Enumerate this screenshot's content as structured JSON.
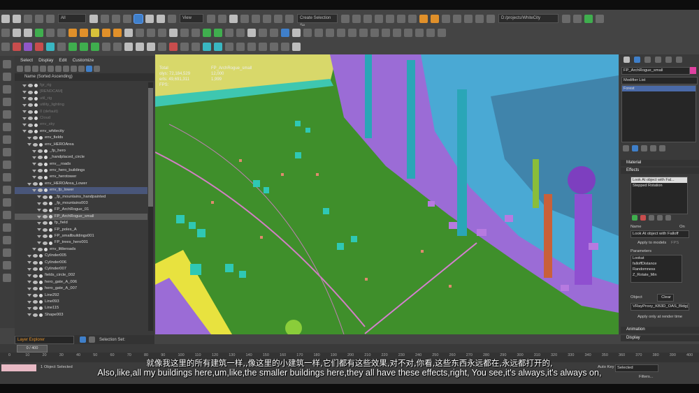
{
  "toolbar": {
    "filter_dropdown": "All",
    "view_dropdown": "View",
    "selection_set": "Create Selection Se",
    "project_path": "D:/projects/WhiteCity"
  },
  "explorer": {
    "menu": [
      "Select",
      "Display",
      "Edit",
      "Customize"
    ],
    "column_header": "Name (Sorted Ascending)",
    "items": [
      {
        "label": "fgr_rig",
        "depth": 1,
        "state": "dim"
      },
      {
        "label": "[RENDCAM]",
        "depth": 1,
        "state": "dim"
      },
      {
        "label": "util_rig",
        "depth": 1,
        "state": "dim"
      },
      {
        "label": "utility_lighting",
        "depth": 1,
        "state": "dim"
      },
      {
        "label": "0 (default)",
        "depth": 1,
        "state": "dim"
      },
      {
        "label": "Cloud",
        "depth": 1,
        "state": "dim"
      },
      {
        "label": "env_sky",
        "depth": 1,
        "state": "dim"
      },
      {
        "label": "env_whitecity",
        "depth": 1,
        "state": ""
      },
      {
        "label": "env_fields",
        "depth": 2,
        "state": ""
      },
      {
        "label": "env_HEROArea",
        "depth": 2,
        "state": ""
      },
      {
        "label": "_fp_hero",
        "depth": 3,
        "state": ""
      },
      {
        "label": "_handplaced_circle",
        "depth": 3,
        "state": ""
      },
      {
        "label": "env__roads",
        "depth": 3,
        "state": ""
      },
      {
        "label": "env_hero_buildings",
        "depth": 3,
        "state": ""
      },
      {
        "label": "env_herotower",
        "depth": 3,
        "state": ""
      },
      {
        "label": "env_HEROArea_Lower",
        "depth": 2,
        "state": ""
      },
      {
        "label": "env_fp_lower",
        "depth": 3,
        "state": "sel"
      },
      {
        "label": "_fp_mountains_handpainted",
        "depth": 4,
        "state": ""
      },
      {
        "label": "_fp_mountains003",
        "depth": 4,
        "state": ""
      },
      {
        "label": "FP_ArchRogue_01",
        "depth": 4,
        "state": ""
      },
      {
        "label": "FP_ArchRogue_small",
        "depth": 4,
        "state": "sel2"
      },
      {
        "label": "fp_field",
        "depth": 4,
        "state": ""
      },
      {
        "label": "FP_poles_A",
        "depth": 4,
        "state": ""
      },
      {
        "label": "FP_smallbuildings001",
        "depth": 4,
        "state": ""
      },
      {
        "label": "FP_trees_hero001",
        "depth": 4,
        "state": ""
      },
      {
        "label": "env_littleroads",
        "depth": 3,
        "state": ""
      },
      {
        "label": "Cylinder005",
        "depth": 2,
        "state": ""
      },
      {
        "label": "Cylinder006",
        "depth": 2,
        "state": ""
      },
      {
        "label": "Cylinder007",
        "depth": 2,
        "state": ""
      },
      {
        "label": "fields_circle_002",
        "depth": 2,
        "state": ""
      },
      {
        "label": "hero_gate_A_006",
        "depth": 2,
        "state": ""
      },
      {
        "label": "hero_gate_A_007",
        "depth": 2,
        "state": ""
      },
      {
        "label": "Line292",
        "depth": 2,
        "state": ""
      },
      {
        "label": "Line093",
        "depth": 2,
        "state": ""
      },
      {
        "label": "Line115",
        "depth": 2,
        "state": ""
      },
      {
        "label": "Shape003",
        "depth": 2,
        "state": ""
      }
    ],
    "layer_label": "Layer Explorer",
    "selection_set_label": "Selection Set:"
  },
  "viewport": {
    "stats_labels": [
      "Total",
      "olys: 72,184,529",
      "erts: 49,691,311",
      "FPS:"
    ],
    "stats_object": [
      "FP_ArchRogue_small",
      "12,000",
      "1,999"
    ]
  },
  "command_panel": {
    "object_name": "FP_ArchRogue_small",
    "object_color": "#e040a0",
    "modifier_list_label": "Modifier List",
    "modifier_stack": [
      "Forest"
    ],
    "section_material": "Material",
    "section_effects": "Effects",
    "effects_list": [
      "Look At object with Fal...",
      "Stepped Rotation"
    ],
    "name_label": "Name",
    "on_label": "On",
    "name_value": "Look At object with Falloff",
    "apply_models": "Apply to models",
    "fps_label": "FPS",
    "parameters_label": "Parameters",
    "parameters": [
      "Lookat",
      "falloffDistance",
      "Randomness",
      "Z_Rotate_Min"
    ],
    "object_label": "Object",
    "clear_label": "Clear",
    "object_value": "VRayProxy_KB3D_OAS_Bldg(",
    "apply_render_time": "Apply only at render time",
    "section_animation": "Animation",
    "section_display": "Display"
  },
  "timeline": {
    "slider_label": "0 / 400",
    "ticks": [
      "0",
      "10",
      "20",
      "30",
      "40",
      "50",
      "60",
      "70",
      "80",
      "90",
      "100",
      "110",
      "120",
      "130",
      "140",
      "150",
      "160",
      "170",
      "180",
      "190",
      "200",
      "210",
      "220",
      "230",
      "240",
      "250",
      "260",
      "270",
      "280",
      "290",
      "300",
      "310",
      "320",
      "330",
      "340",
      "350",
      "360",
      "370",
      "380",
      "390",
      "400"
    ]
  },
  "status": {
    "objects_selected": "1 Object Selected",
    "auto_key": "Auto Key",
    "selected": "Selected",
    "filters": "Filters..."
  },
  "subtitles": {
    "cn": "就像我这里的所有建筑一样,,像这里的小建筑一样,它们都有这些效果,对不对,你看,这些东西永远都在,永远都打开的,",
    "en": "Also,like,all my buildings here,um,like,the smaller buildings here,they all have these effects,right, You see,it's always,it's always on,"
  }
}
